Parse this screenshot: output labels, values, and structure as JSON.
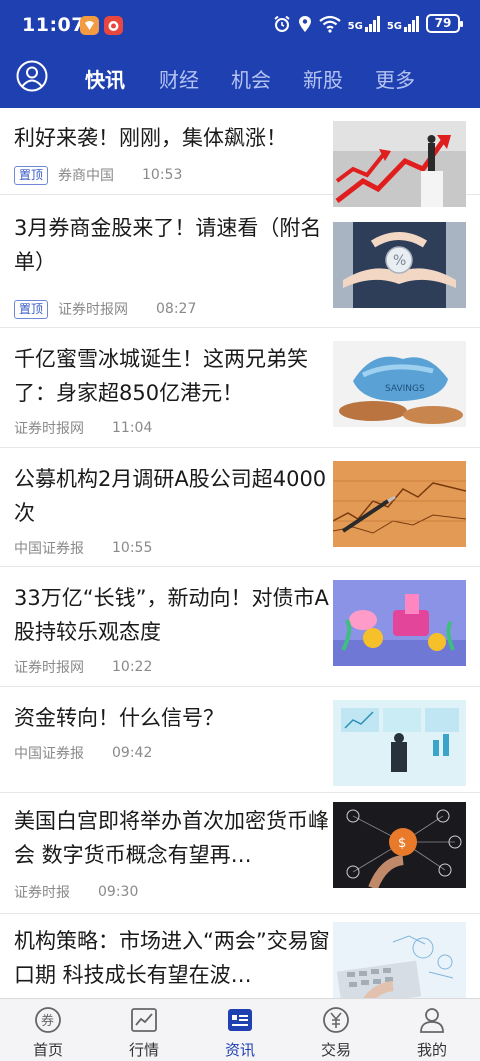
{
  "status_bar": {
    "time": "11:07",
    "battery": "79",
    "signal_1": "5G",
    "signal_2": "5G"
  },
  "top_tabs": [
    {
      "label": "快讯",
      "active": true
    },
    {
      "label": "财经",
      "active": false
    },
    {
      "label": "机会",
      "active": false
    },
    {
      "label": "新股",
      "active": false
    },
    {
      "label": "更多",
      "active": false
    }
  ],
  "news": [
    {
      "title": "利好来袭！刚刚，集体飙涨！",
      "pinned": true,
      "pin_label": "置顶",
      "source": "券商中国",
      "time": "10:53",
      "thumb": "arrows-chart"
    },
    {
      "title": "3月券商金股来了！请速看（附名单）",
      "pinned": true,
      "pin_label": "置顶",
      "source": "证券时报网",
      "time": "08:27",
      "thumb": "hands-percent"
    },
    {
      "title": "千亿蜜雪冰城诞生！这两兄弟笑了：身家超850亿港元！",
      "pinned": false,
      "source": "证券时报网",
      "time": "11:04",
      "thumb": "savings-coins"
    },
    {
      "title": "公募机构2月调研A股公司超4000次",
      "pinned": false,
      "source": "中国证券报",
      "time": "10:55",
      "thumb": "pen-chart"
    },
    {
      "title": "33万亿“长钱”，新动向！对债市A股持较乐观态度",
      "pinned": false,
      "source": "证券时报网",
      "time": "10:22",
      "thumb": "money-illustration"
    },
    {
      "title": "资金转向！什么信号？",
      "pinned": false,
      "source": "中国证券报",
      "time": "09:42",
      "thumb": "man-dashboard"
    },
    {
      "title": "美国白宫即将举办首次加密货币峰会 数字货币概念有望再…",
      "pinned": false,
      "source": "证券时报",
      "time": "09:30",
      "thumb": "crypto-network"
    },
    {
      "title": "机构策略：市场进入“两会”交易窗口期 科技成长有望在波…",
      "pinned": false,
      "source": "",
      "time": "",
      "thumb": "keyboard-analytics"
    }
  ],
  "bottom_nav": [
    {
      "label": "首页",
      "icon": "coupon-icon",
      "active": false
    },
    {
      "label": "行情",
      "icon": "chart-icon",
      "active": false
    },
    {
      "label": "资讯",
      "icon": "news-icon",
      "active": true
    },
    {
      "label": "交易",
      "icon": "yen-icon",
      "active": false
    },
    {
      "label": "我的",
      "icon": "user-icon",
      "active": false
    }
  ],
  "colors": {
    "brand": "#1f40b0",
    "tab_inactive": "#b5c3f3",
    "pin_badge": "#3a5bc7"
  }
}
